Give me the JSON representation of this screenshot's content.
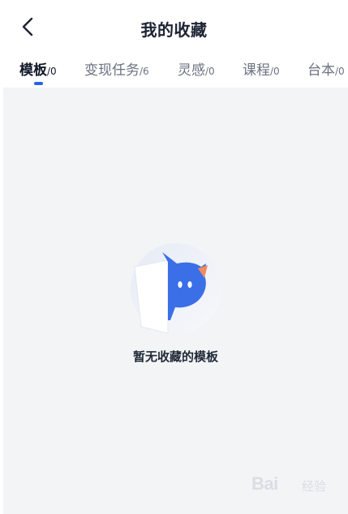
{
  "header": {
    "title": "我的收藏"
  },
  "tabs": [
    {
      "label": "模板",
      "count": "/0",
      "active": true
    },
    {
      "label": "变现任务",
      "count": "/6",
      "active": false
    },
    {
      "label": "灵感",
      "count": "/0",
      "active": false
    },
    {
      "label": "课程",
      "count": "/0",
      "active": false
    },
    {
      "label": "台本",
      "count": "/0",
      "active": false
    }
  ],
  "empty_state": {
    "message": "暂无收藏的模板",
    "icon": "empty-mascot-illustration"
  },
  "watermark": {
    "logo": "Bai",
    "sub": "经验"
  },
  "colors": {
    "accent": "#2563eb",
    "mascot_blue": "#3b6fe8",
    "mascot_ear": "#f08a5d",
    "content_bg": "#f3f4f6"
  }
}
